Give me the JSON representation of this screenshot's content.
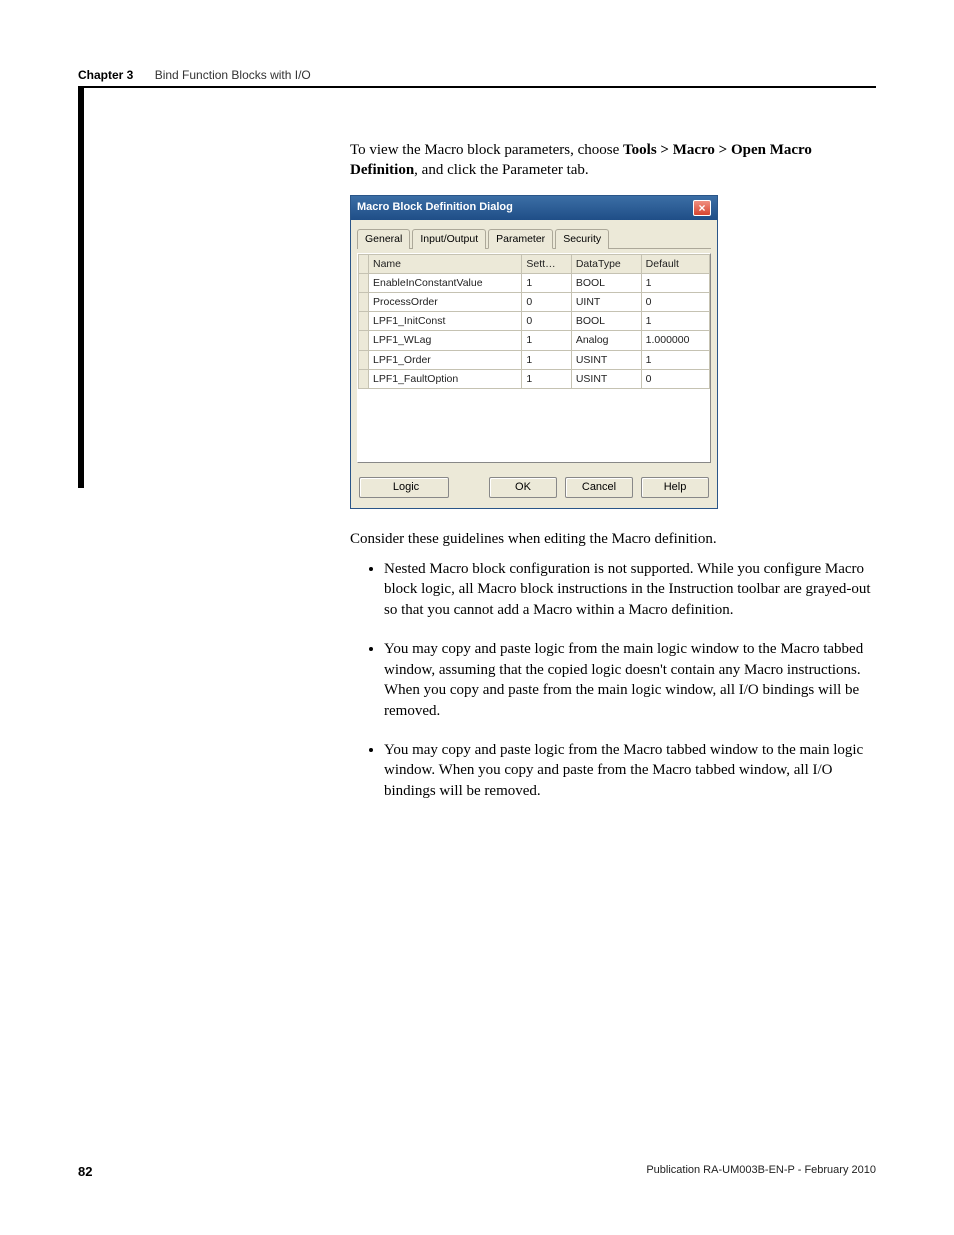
{
  "header": {
    "chapter_label": "Chapter 3",
    "chapter_title": "Bind Function Blocks with I/O"
  },
  "intro": {
    "text_prefix": "To view the Macro block parameters, choose ",
    "text_bold1": "Tools > Macro > Open Macro Definition",
    "text_suffix": ", and click the Parameter tab."
  },
  "dialog": {
    "title": "Macro Block Definition Dialog",
    "close": "×",
    "tabs": [
      "General",
      "Input/Output",
      "Parameter",
      "Security"
    ],
    "active_tab": 2,
    "columns": [
      "Name",
      "Sett…",
      "DataType",
      "Default"
    ],
    "rows": [
      {
        "name": "EnableInConstantValue",
        "sett": "1",
        "dtype": "BOOL",
        "def": "1"
      },
      {
        "name": "ProcessOrder",
        "sett": "0",
        "dtype": "UINT",
        "def": "0"
      },
      {
        "name": "LPF1_InitConst",
        "sett": "0",
        "dtype": "BOOL",
        "def": "1"
      },
      {
        "name": "LPF1_WLag",
        "sett": "1",
        "dtype": "Analog",
        "def": "1.000000"
      },
      {
        "name": "LPF1_Order",
        "sett": "1",
        "dtype": "USINT",
        "def": "1"
      },
      {
        "name": "LPF1_FaultOption",
        "sett": "1",
        "dtype": "USINT",
        "def": "0"
      }
    ],
    "buttons": {
      "logic": "Logic",
      "ok": "OK",
      "cancel": "Cancel",
      "help": "Help"
    }
  },
  "guideline_intro": "Consider these guidelines when editing the Macro definition.",
  "bullets": [
    "Nested Macro block configuration is not supported. While you configure Macro block logic, all Macro block instructions in the Instruction toolbar are grayed-out so that you cannot add a Macro within a Macro definition.",
    "You may copy and paste logic from the main logic window to the Macro tabbed window, assuming that the copied logic doesn't contain any Macro instructions. When you copy and paste from the main logic window, all I/O bindings will be removed.",
    "You may copy and paste logic from the Macro tabbed window to the main logic window. When you copy and paste from the Macro tabbed window, all I/O bindings will be removed."
  ],
  "footer": {
    "page_number": "82",
    "publication": "Publication RA-UM003B-EN-P - February 2010"
  }
}
